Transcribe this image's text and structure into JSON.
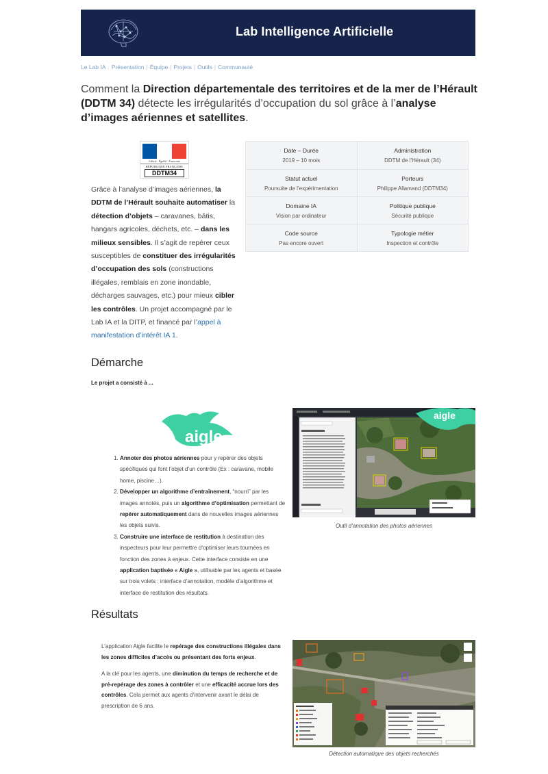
{
  "header": {
    "title": "Lab Intelligence Artificielle"
  },
  "nav": {
    "items": [
      "Le Lab IA",
      "Présentation",
      "Équipe",
      "Projets",
      "Outils",
      "Communauté"
    ]
  },
  "headline": {
    "p1": "Comment la ",
    "b1": "Direction départementale des territoires et de la mer de l’Hérault (DDTM 34)",
    "p2": " détecte les irrégularités d’occupation du sol grâce à l’",
    "b2": "analyse d’images aériennes et satellites",
    "p3": "."
  },
  "logo": {
    "motto": "Liberté · Égalité · Fraternité",
    "republic": "RÉPUBLIQUE FRANÇAISE",
    "code": "DDTM34",
    "colors": {
      "blue": "#0055a4",
      "white": "#ffffff",
      "red": "#ef4135"
    }
  },
  "intro": {
    "t1": "Grâce à l’analyse d’images aériennes, ",
    "b1": "la DDTM de l’Hérault souhaite automatiser",
    "t2": " la ",
    "b2": "détection d’objets",
    "t3": " – caravanes, bâtis, hangars agricoles, déchets, etc. – ",
    "b3": "dans les milieux sensibles",
    "t4": ". Il s’agit de repérer ceux susceptibles de ",
    "b4": "constituer des irrégularités d’occupation des sols",
    "t5": " (constructions illégales, remblais en zone inondable, décharges sauvages, etc.) pour mieux ",
    "b5": "cibler les contrôles",
    "t6": ". Un projet accompagné par le Lab IA et la DITP, et financé par l’",
    "link": "appel à manifestation d’intérêt IA 1",
    "t7": "."
  },
  "info_table": [
    [
      {
        "label": "Date – Durée",
        "value": "2019 – 10 mois"
      },
      {
        "label": "Administration",
        "value": "DDTM de l’Hérault (34)"
      }
    ],
    [
      {
        "label": "Statut actuel",
        "value": "Poursuite de l’expérimentation"
      },
      {
        "label": "Porteurs",
        "value": "Philippe Allamand (DDTM34)"
      }
    ],
    [
      {
        "label": "Domaine IA",
        "value": "Vision par ordinateur"
      },
      {
        "label": "Politique publique",
        "value": "Sécurité publique"
      }
    ],
    [
      {
        "label": "Code source",
        "value": "Pas encore ouvert"
      },
      {
        "label": "Typologie métier",
        "value": "Inspection et contrôle"
      }
    ]
  ],
  "demarche": {
    "heading": "Démarche",
    "lead": "Le projet a consisté à ...",
    "aigle_logo": "aigle",
    "steps": [
      {
        "b1": "Annoter des photos aériennes",
        "t1": " pour y repérer des objets spécifiques qui font l’objet d’un contrôle (Ex : caravane, mobile home, piscine…)."
      },
      {
        "b1": "Développer un algorithme d’entraînement",
        "t1": ", “nourri” par les images annotés, puis un ",
        "b2": "algorithme d’optimisation",
        "t2": " permettant de ",
        "b3": "repérer automatiquement",
        "t3": " dans de nouvelles images aériennes les objets suivis."
      },
      {
        "b1": "Construire une interface de restitution",
        "t1": " à destination des inspecteurs pour leur permettre d’optimiser leurs tournées en fonction des zones à enjeux. Cette interface consiste en une ",
        "b2": "application baptisée « Aigle »",
        "t2": ", utilisable par les agents et basée sur trois volets : interface d’annotation, modèle d’algorithme et interface de restitution des résultats."
      }
    ],
    "figure_caption": "Outil d’annotation des photos aériennes"
  },
  "resultats": {
    "heading": "Résultats",
    "p1": {
      "t1": "L’application Aigle facilite le ",
      "b1": "repérage des constructions illégales dans les zones difficiles d’accès ou présentant des forts enjeux",
      "t2": "."
    },
    "p2": {
      "t1": "A la clé pour les agents, une ",
      "b1": "diminution du temps de recherche et de pré-repérage des zones à contrôler",
      "t2": " et une ",
      "b2": "efficacité accrue lors des contrôles",
      "t3": ". Cela permet aux agents d’intervenir avant le délai de prescription de 6 ans."
    },
    "figure_caption": "Détection automatique des objets recherchés"
  }
}
